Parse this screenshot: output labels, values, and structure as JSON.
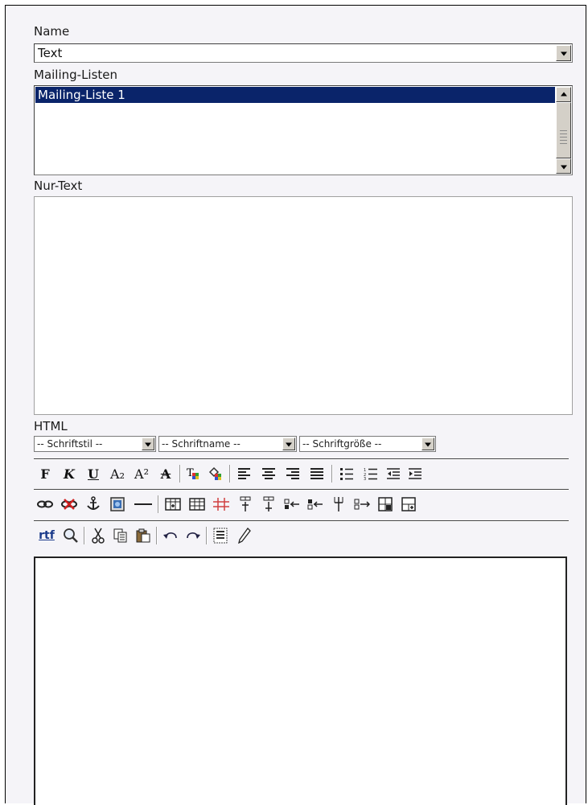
{
  "name_label": "Name",
  "name_select_value": "Text",
  "mailing_label": "Mailing-Listen",
  "mailing_options": [
    "Mailing-Liste 1"
  ],
  "nurtext_label": "Nur-Text",
  "html_label": "HTML",
  "font_selects": {
    "style": "-- Schriftstil --",
    "name": "-- Schriftname --",
    "size": "-- Schriftgröße --"
  },
  "toolbar_icons": {
    "row1": [
      "bold-icon",
      "italic-icon",
      "underline-icon",
      "subscript-icon",
      "superscript-icon",
      "strikethrough-icon",
      "text-color-icon",
      "background-color-icon",
      "align-left-icon",
      "align-center-icon",
      "align-right-icon",
      "justify-icon",
      "unordered-list-icon",
      "ordered-list-icon",
      "outdent-icon",
      "indent-icon"
    ],
    "row2": [
      "link-icon",
      "unlink-icon",
      "anchor-icon",
      "image-icon",
      "horizontal-rule-icon",
      "insert-table-icon",
      "table-properties-icon",
      "cell-properties-icon",
      "insert-row-above-icon",
      "insert-row-below-icon",
      "delete-row-icon",
      "insert-column-left-icon",
      "insert-column-right-icon",
      "delete-column-icon",
      "merge-cells-icon",
      "split-cell-icon"
    ],
    "row3": [
      "paste-rtf-icon",
      "find-icon",
      "cut-icon",
      "copy-icon",
      "paste-icon",
      "undo-icon",
      "redo-icon",
      "select-all-icon",
      "edit-source-icon"
    ]
  },
  "button_glyphs": {
    "bold": "F",
    "italic": "K",
    "underline": "U",
    "subscript": "A₂",
    "superscript": "A²",
    "strikethrough": "A",
    "rtf": "rtf"
  },
  "colors": {
    "selection": "#0a246a",
    "background": "#f5f4f8"
  }
}
